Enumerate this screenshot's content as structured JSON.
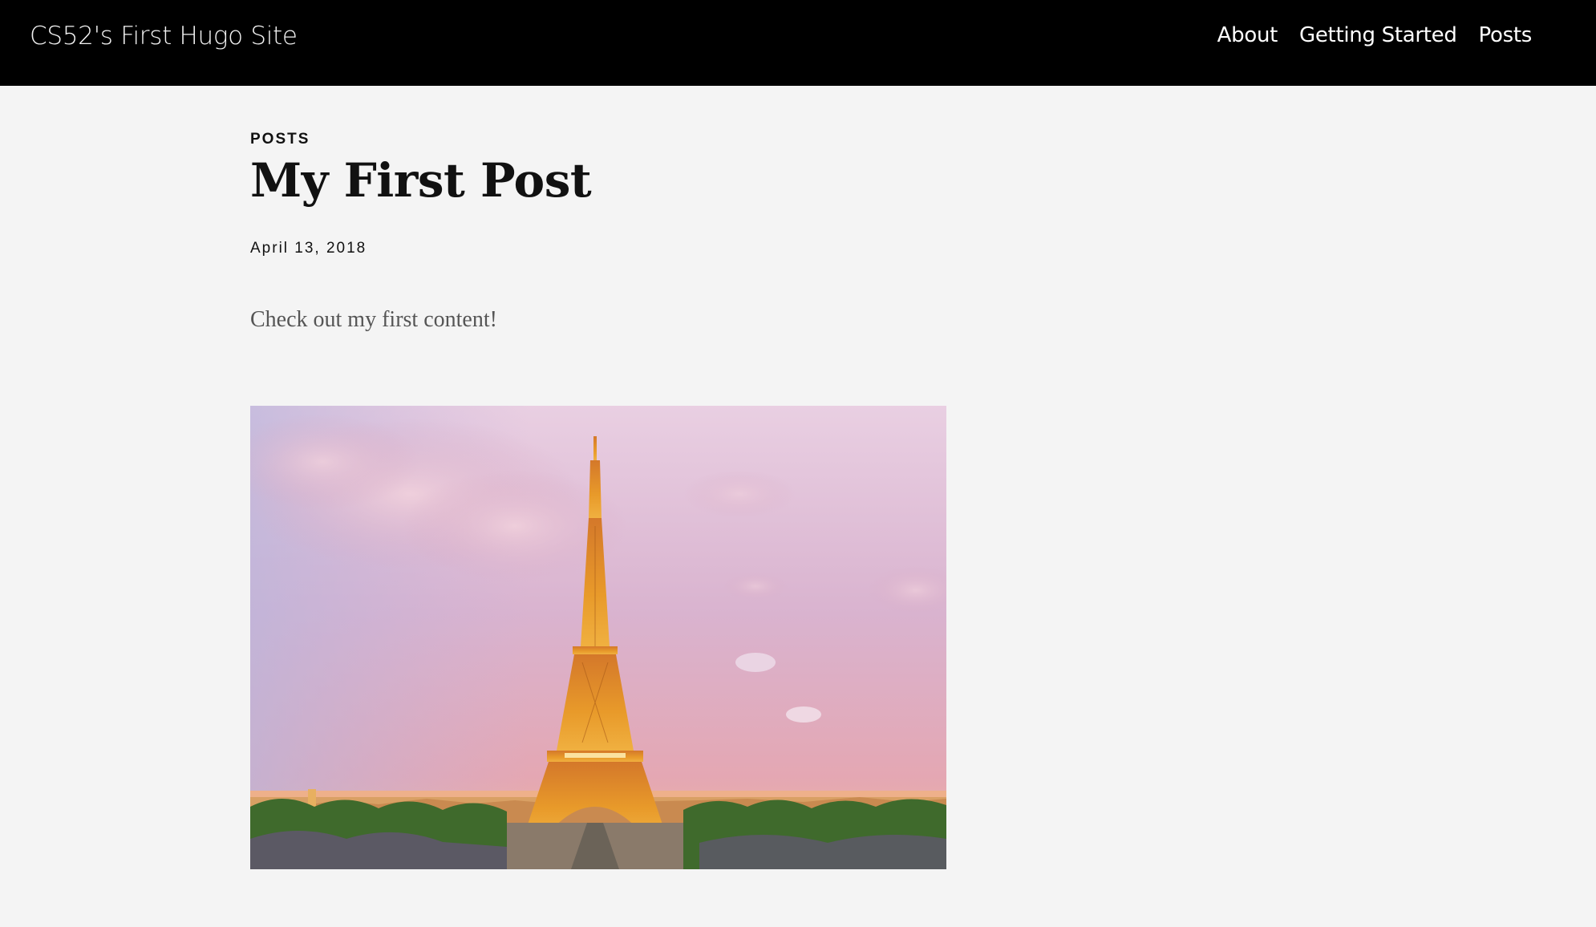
{
  "header": {
    "site_title": "CS52's First Hugo Site",
    "nav": [
      {
        "label": "About"
      },
      {
        "label": "Getting Started"
      },
      {
        "label": "Posts"
      }
    ]
  },
  "post": {
    "section": "POSTS",
    "title": "My First Post",
    "date": "April 13, 2018",
    "body": "Check out my first content!",
    "image": {
      "subject": "eiffel-tower-at-sunset"
    }
  },
  "colors": {
    "header_bg": "#000000",
    "page_bg": "#f4f4f4",
    "sky_top": "#e7c9dc",
    "tower_gold": "#e2901e"
  }
}
